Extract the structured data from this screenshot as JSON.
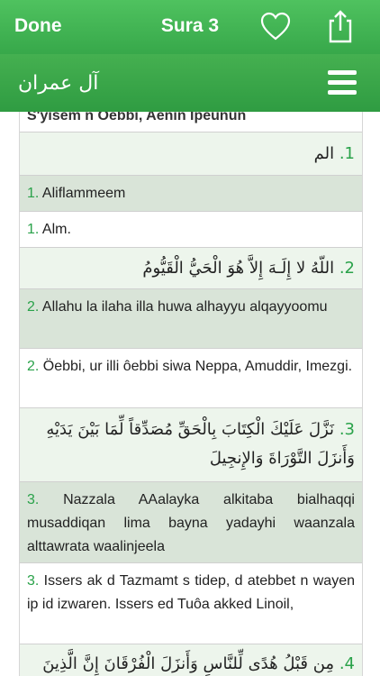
{
  "topbar": {
    "done_label": "Done",
    "title": "Sura 3"
  },
  "subbar": {
    "surah_name_arabic": "آل عمران"
  },
  "header": {
    "title": "S'yisem n Oebbi, Aenin Ipeunun"
  },
  "verses": [
    {
      "num": "1.",
      "arabic": "الم",
      "transliteration": "Aliflammeem",
      "translation": "Alm."
    },
    {
      "num": "2.",
      "arabic": "اللّهُ لا إِلَـهَ إِلاَّ هُوَ الْحَيُّ الْقَيُّومُ",
      "transliteration": "Allahu la ilaha illa huwa alhayyu alqayyoomu",
      "translation": "Öebbi, ur illi ôebbi siwa Neppa, Amuddir, Imezgi."
    },
    {
      "num": "3.",
      "arabic": "نَزَّلَ عَلَيْكَ الْكِتَابَ بِالْحَقِّ مُصَدِّقاً لِّمَا بَيْنَ يَدَيْهِ وَأَنزَلَ التَّوْرَاةَ وَالإِنجِيلَ",
      "transliteration": "Nazzala AAalayka alkitaba bialhaqqi musaddiqan lima bayna yadayhi waanzala alttawrata waalinjeela",
      "translation": "Issers ak d Tazmamt s tidep, d atebbet n wayen ip id izwaren. Issers ed Tuôa akked Linoil,"
    },
    {
      "num": "4.",
      "arabic": "مِن قَبْلُ هُدًى لِّلنَّاسِ وَأَنزَلَ الْفُرْقَانَ إِنَّ الَّذِينَ"
    }
  ]
}
